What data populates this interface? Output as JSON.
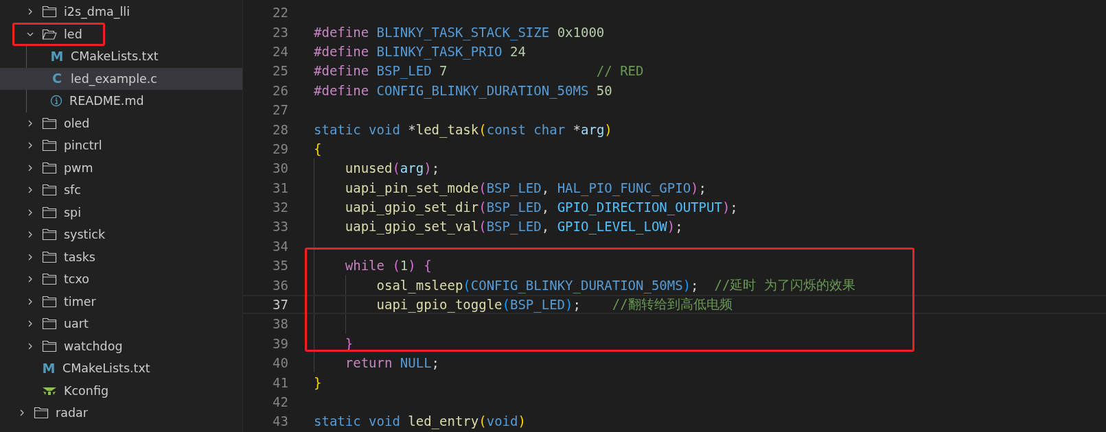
{
  "tree": [
    {
      "kind": "offscreen-folder",
      "children": [
        {
          "kind": "folder",
          "label": "i2s_dma_lli",
          "expanded": false,
          "selected": false,
          "boxed": false
        },
        {
          "kind": "folder",
          "label": "led",
          "expanded": true,
          "selected": false,
          "boxed": true,
          "children": [
            {
              "kind": "file",
              "label": "CMakeLists.txt",
              "icon": {
                "kind": "letter",
                "glyph": "M"
              },
              "selected": false,
              "boxed": false
            },
            {
              "kind": "file",
              "label": "led_example.c",
              "icon": {
                "kind": "letter",
                "glyph": "C"
              },
              "selected": true,
              "boxed": false
            },
            {
              "kind": "file",
              "label": "README.md",
              "icon": {
                "kind": "info"
              },
              "selected": false,
              "boxed": false
            }
          ]
        },
        {
          "kind": "folder",
          "label": "oled",
          "expanded": false,
          "selected": false,
          "boxed": false
        },
        {
          "kind": "folder",
          "label": "pinctrl",
          "expanded": false,
          "selected": false,
          "boxed": false
        },
        {
          "kind": "folder",
          "label": "pwm",
          "expanded": false,
          "selected": false,
          "boxed": false
        },
        {
          "kind": "folder",
          "label": "sfc",
          "expanded": false,
          "selected": false,
          "boxed": false
        },
        {
          "kind": "folder",
          "label": "spi",
          "expanded": false,
          "selected": false,
          "boxed": false
        },
        {
          "kind": "folder",
          "label": "systick",
          "expanded": false,
          "selected": false,
          "boxed": false
        },
        {
          "kind": "folder",
          "label": "tasks",
          "expanded": false,
          "selected": false,
          "boxed": false
        },
        {
          "kind": "folder",
          "label": "tcxo",
          "expanded": false,
          "selected": false,
          "boxed": false
        },
        {
          "kind": "folder",
          "label": "timer",
          "expanded": false,
          "selected": false,
          "boxed": false
        },
        {
          "kind": "folder",
          "label": "uart",
          "expanded": false,
          "selected": false,
          "boxed": false
        },
        {
          "kind": "folder",
          "label": "watchdog",
          "expanded": false,
          "selected": false,
          "boxed": false
        },
        {
          "kind": "file",
          "label": "CMakeLists.txt",
          "icon": {
            "kind": "letter",
            "glyph": "M"
          },
          "selected": false,
          "boxed": false
        },
        {
          "kind": "file",
          "label": "Kconfig",
          "icon": {
            "kind": "kconfig"
          },
          "selected": false,
          "boxed": false
        }
      ]
    },
    {
      "kind": "folder",
      "label": "radar",
      "expanded": false,
      "selected": false,
      "boxed": false
    }
  ],
  "code": {
    "lines": [
      {
        "kind": "line",
        "number": "22",
        "current": false
      },
      {
        "kind": "line",
        "number": "23",
        "current": false,
        "tokens": [
          {
            "kind": "keyword",
            "text": "#define"
          },
          {
            "kind": "macro",
            "text": " BLINKY_TASK_STACK_SIZE"
          },
          {
            "kind": "number",
            "text": " 0x1000"
          }
        ]
      },
      {
        "kind": "line",
        "number": "24",
        "current": false,
        "tokens": [
          {
            "kind": "keyword",
            "text": "#define"
          },
          {
            "kind": "macro",
            "text": " BLINKY_TASK_PRIO"
          },
          {
            "kind": "number",
            "text": " 24"
          }
        ]
      },
      {
        "kind": "line",
        "number": "25",
        "current": false,
        "tokens": [
          {
            "kind": "keyword",
            "text": "#define"
          },
          {
            "kind": "macro",
            "text": " BSP_LED"
          },
          {
            "kind": "number",
            "text": " 7"
          },
          {
            "kind": "comment",
            "text": "                   // RED"
          }
        ]
      },
      {
        "kind": "line",
        "number": "26",
        "current": false,
        "tokens": [
          {
            "kind": "keyword",
            "text": "#define"
          },
          {
            "kind": "macro",
            "text": " CONFIG_BLINKY_DURATION_50MS"
          },
          {
            "kind": "number",
            "text": " 50"
          }
        ]
      },
      {
        "kind": "line",
        "number": "27",
        "current": false
      },
      {
        "kind": "line",
        "number": "28",
        "current": false,
        "tokens": [
          {
            "kind": "type",
            "text": "static"
          },
          {
            "kind": "type",
            "text": " void"
          },
          {
            "kind": "plain",
            "text": " *"
          },
          {
            "kind": "func",
            "text": "led_task"
          },
          {
            "kind": "bracket1",
            "text": "("
          },
          {
            "kind": "type",
            "text": "const"
          },
          {
            "kind": "type",
            "text": " char"
          },
          {
            "kind": "plain",
            "text": " *"
          },
          {
            "kind": "param",
            "text": "arg"
          },
          {
            "kind": "bracket1",
            "text": ")"
          }
        ]
      },
      {
        "kind": "line",
        "number": "29",
        "current": false,
        "tokens": [
          {
            "kind": "bracket1",
            "text": "{"
          }
        ]
      },
      {
        "kind": "line",
        "number": "30",
        "current": false,
        "indent": [
          {
            "kind": "guide"
          }
        ],
        "tokens": [
          {
            "kind": "func",
            "text": "unused"
          },
          {
            "kind": "bracket2",
            "text": "("
          },
          {
            "kind": "param",
            "text": "arg"
          },
          {
            "kind": "bracket2",
            "text": ")"
          },
          {
            "kind": "plain",
            "text": ";"
          }
        ]
      },
      {
        "kind": "line",
        "number": "31",
        "current": false,
        "indent": [
          {
            "kind": "guide"
          }
        ],
        "tokens": [
          {
            "kind": "func",
            "text": "uapi_pin_set_mode"
          },
          {
            "kind": "bracket2",
            "text": "("
          },
          {
            "kind": "macro",
            "text": "BSP_LED"
          },
          {
            "kind": "plain",
            "text": ","
          },
          {
            "kind": "macro",
            "text": " HAL_PIO_FUNC_GPIO"
          },
          {
            "kind": "bracket2",
            "text": ")"
          },
          {
            "kind": "plain",
            "text": ";"
          }
        ]
      },
      {
        "kind": "line",
        "number": "32",
        "current": false,
        "indent": [
          {
            "kind": "guide"
          }
        ],
        "tokens": [
          {
            "kind": "func",
            "text": "uapi_gpio_set_dir"
          },
          {
            "kind": "bracket2",
            "text": "("
          },
          {
            "kind": "macro",
            "text": "BSP_LED"
          },
          {
            "kind": "plain",
            "text": ","
          },
          {
            "kind": "constant",
            "text": " GPIO_DIRECTION_OUTPUT"
          },
          {
            "kind": "bracket2",
            "text": ")"
          },
          {
            "kind": "plain",
            "text": ";"
          }
        ]
      },
      {
        "kind": "line",
        "number": "33",
        "current": false,
        "indent": [
          {
            "kind": "guide"
          }
        ],
        "tokens": [
          {
            "kind": "func",
            "text": "uapi_gpio_set_val"
          },
          {
            "kind": "bracket2",
            "text": "("
          },
          {
            "kind": "macro",
            "text": "BSP_LED"
          },
          {
            "kind": "plain",
            "text": ","
          },
          {
            "kind": "constant",
            "text": " GPIO_LEVEL_LOW"
          },
          {
            "kind": "bracket2",
            "text": ")"
          },
          {
            "kind": "plain",
            "text": ";"
          }
        ]
      },
      {
        "kind": "line",
        "number": "34",
        "current": false,
        "indent": [
          {
            "kind": "guide"
          }
        ]
      },
      {
        "kind": "boxed-group",
        "lines": [
          {
            "kind": "line",
            "number": "35",
            "current": false,
            "indent": [
              {
                "kind": "guide"
              }
            ],
            "tokens": [
              {
                "kind": "keyword",
                "text": "while"
              },
              {
                "kind": "bracket2",
                "text": " ("
              },
              {
                "kind": "number",
                "text": "1"
              },
              {
                "kind": "bracket2",
                "text": ")"
              },
              {
                "kind": "bracket2",
                "text": " {"
              }
            ]
          },
          {
            "kind": "line",
            "number": "36",
            "current": false,
            "indent": [
              {
                "kind": "guide"
              },
              {
                "kind": "guide"
              }
            ],
            "tokens": [
              {
                "kind": "func",
                "text": "osal_msleep"
              },
              {
                "kind": "bracket3",
                "text": "("
              },
              {
                "kind": "macro",
                "text": "CONFIG_BLINKY_DURATION_50MS"
              },
              {
                "kind": "bracket3",
                "text": ")"
              },
              {
                "kind": "plain",
                "text": ";"
              },
              {
                "kind": "comment",
                "text": "  //延时 为了闪烁的效果"
              }
            ]
          },
          {
            "kind": "line",
            "number": "37",
            "current": true,
            "indent": [
              {
                "kind": "guide"
              },
              {
                "kind": "guide"
              }
            ],
            "tokens": [
              {
                "kind": "func",
                "text": "uapi_gpio_toggle"
              },
              {
                "kind": "bracket3",
                "text": "("
              },
              {
                "kind": "macro",
                "text": "BSP_LED"
              },
              {
                "kind": "bracket3",
                "text": ")"
              },
              {
                "kind": "plain",
                "text": ";"
              },
              {
                "kind": "comment",
                "text": "    //翻转给到高低电频"
              }
            ]
          },
          {
            "kind": "line",
            "number": "38",
            "current": false,
            "indent": [
              {
                "kind": "guide"
              },
              {
                "kind": "guide"
              }
            ]
          },
          {
            "kind": "line",
            "number": "39",
            "current": false,
            "indent": [
              {
                "kind": "guide"
              }
            ],
            "tokens": [
              {
                "kind": "bracket2",
                "text": "}"
              }
            ]
          }
        ]
      },
      {
        "kind": "line",
        "number": "40",
        "current": false,
        "indent": [
          {
            "kind": "guide"
          }
        ],
        "tokens": [
          {
            "kind": "keyword",
            "text": "return"
          },
          {
            "kind": "macro",
            "text": " NULL"
          },
          {
            "kind": "plain",
            "text": ";"
          }
        ]
      },
      {
        "kind": "line",
        "number": "41",
        "current": false,
        "tokens": [
          {
            "kind": "bracket1",
            "text": "}"
          }
        ]
      },
      {
        "kind": "line",
        "number": "42",
        "current": false
      },
      {
        "kind": "line",
        "number": "43",
        "current": false,
        "tokens": [
          {
            "kind": "type",
            "text": "static"
          },
          {
            "kind": "type",
            "text": " void"
          },
          {
            "kind": "func",
            "text": " led_entry"
          },
          {
            "kind": "bracket1",
            "text": "("
          },
          {
            "kind": "type",
            "text": "void"
          },
          {
            "kind": "bracket1",
            "text": ")"
          }
        ]
      }
    ]
  }
}
